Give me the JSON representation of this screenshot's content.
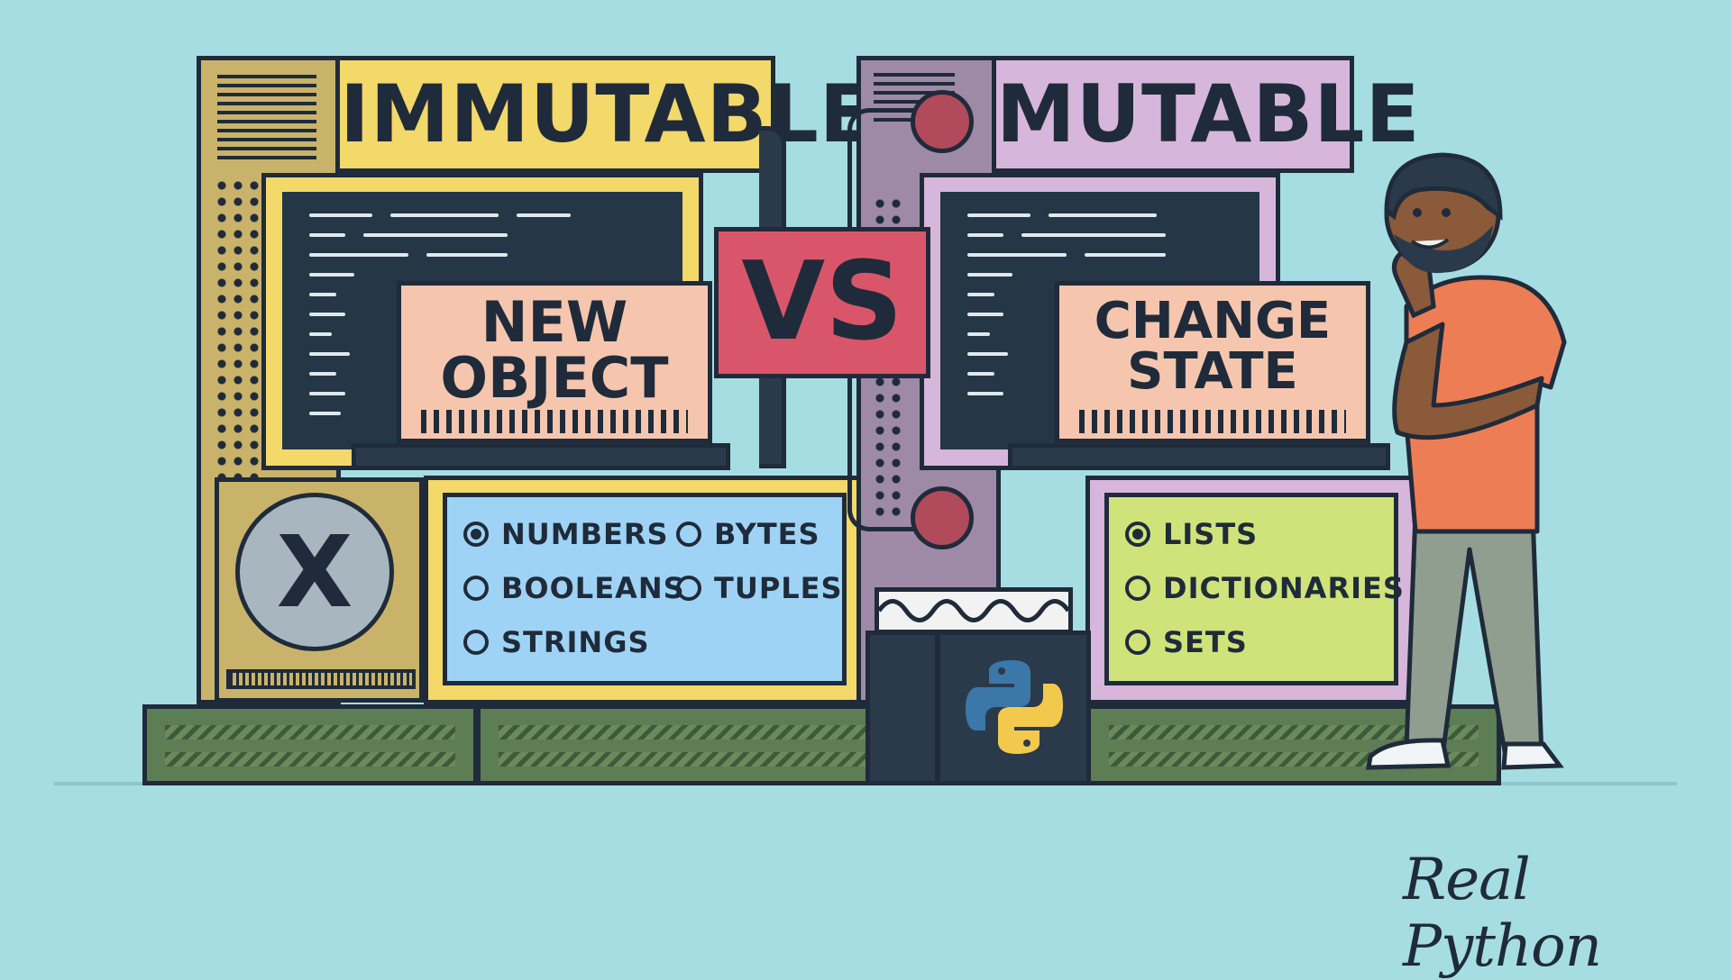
{
  "immutable": {
    "title": "IMMUTABLE",
    "sign_line1": "NEW",
    "sign_line2": "OBJECT",
    "options": [
      {
        "label": "NUMBERS",
        "selected": true
      },
      {
        "label": "BYTES",
        "selected": false
      },
      {
        "label": "BOOLEANS",
        "selected": false
      },
      {
        "label": "TUPLES",
        "selected": false
      },
      {
        "label": "STRINGS",
        "selected": false
      }
    ],
    "button_symbol": "X"
  },
  "vs_label": "VS",
  "mutable": {
    "title": "MUTABLE",
    "sign_line1": "CHANGE",
    "sign_line2": "STATE",
    "options": [
      {
        "label": "LISTS",
        "selected": true
      },
      {
        "label": "DICTIONARIES",
        "selected": false
      },
      {
        "label": "SETS",
        "selected": false
      }
    ]
  },
  "brand": "Real Python",
  "colors": {
    "background": "#a6dde3",
    "immutable_accent": "#f3d86a",
    "mutable_accent": "#d7b6dc",
    "vs_sign": "#d9566a",
    "sign_panel": "#f5c6ad",
    "immutable_options_panel": "#9fd3f5",
    "mutable_options_panel": "#cfe37a",
    "base_green": "#5d7d55"
  },
  "icons": [
    "x-button-icon",
    "python-logo-icon",
    "person-illustration"
  ]
}
